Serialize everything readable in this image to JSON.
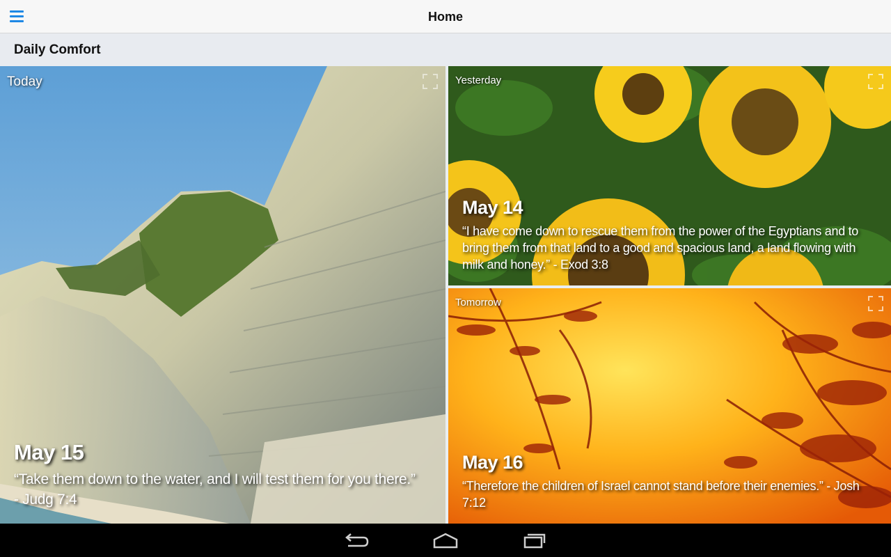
{
  "header": {
    "title": "Home",
    "menu_icon": "menu-icon"
  },
  "section": {
    "title": "Daily Comfort"
  },
  "cards": {
    "today": {
      "label": "Today",
      "date": "May 15",
      "verse": "“Take them down to the water, and I will test them for you there.” - Judg 7:4",
      "image": "cliff-sea-photo"
    },
    "yesterday": {
      "label": "Yesterday",
      "date": "May 14",
      "verse": "“I have come down to rescue them from the power of the Egyptians and to bring them from that land to a good and spacious land, a land flowing with milk and honey.” - Exod 3:8",
      "image": "sunflowers-photo"
    },
    "tomorrow": {
      "label": "Tomorrow",
      "date": "May 16",
      "verse": "“Therefore the children of Israel cannot stand before their enemies.” - Josh 7:12",
      "image": "sunset-branches-photo"
    }
  },
  "navbar": {
    "back_icon": "back-icon",
    "home_icon": "home-icon",
    "recent_icon": "recent-apps-icon"
  },
  "colors": {
    "accent": "#1e88e5",
    "topbar": "#f7f7f7",
    "section_bar": "#e8ebf0"
  }
}
